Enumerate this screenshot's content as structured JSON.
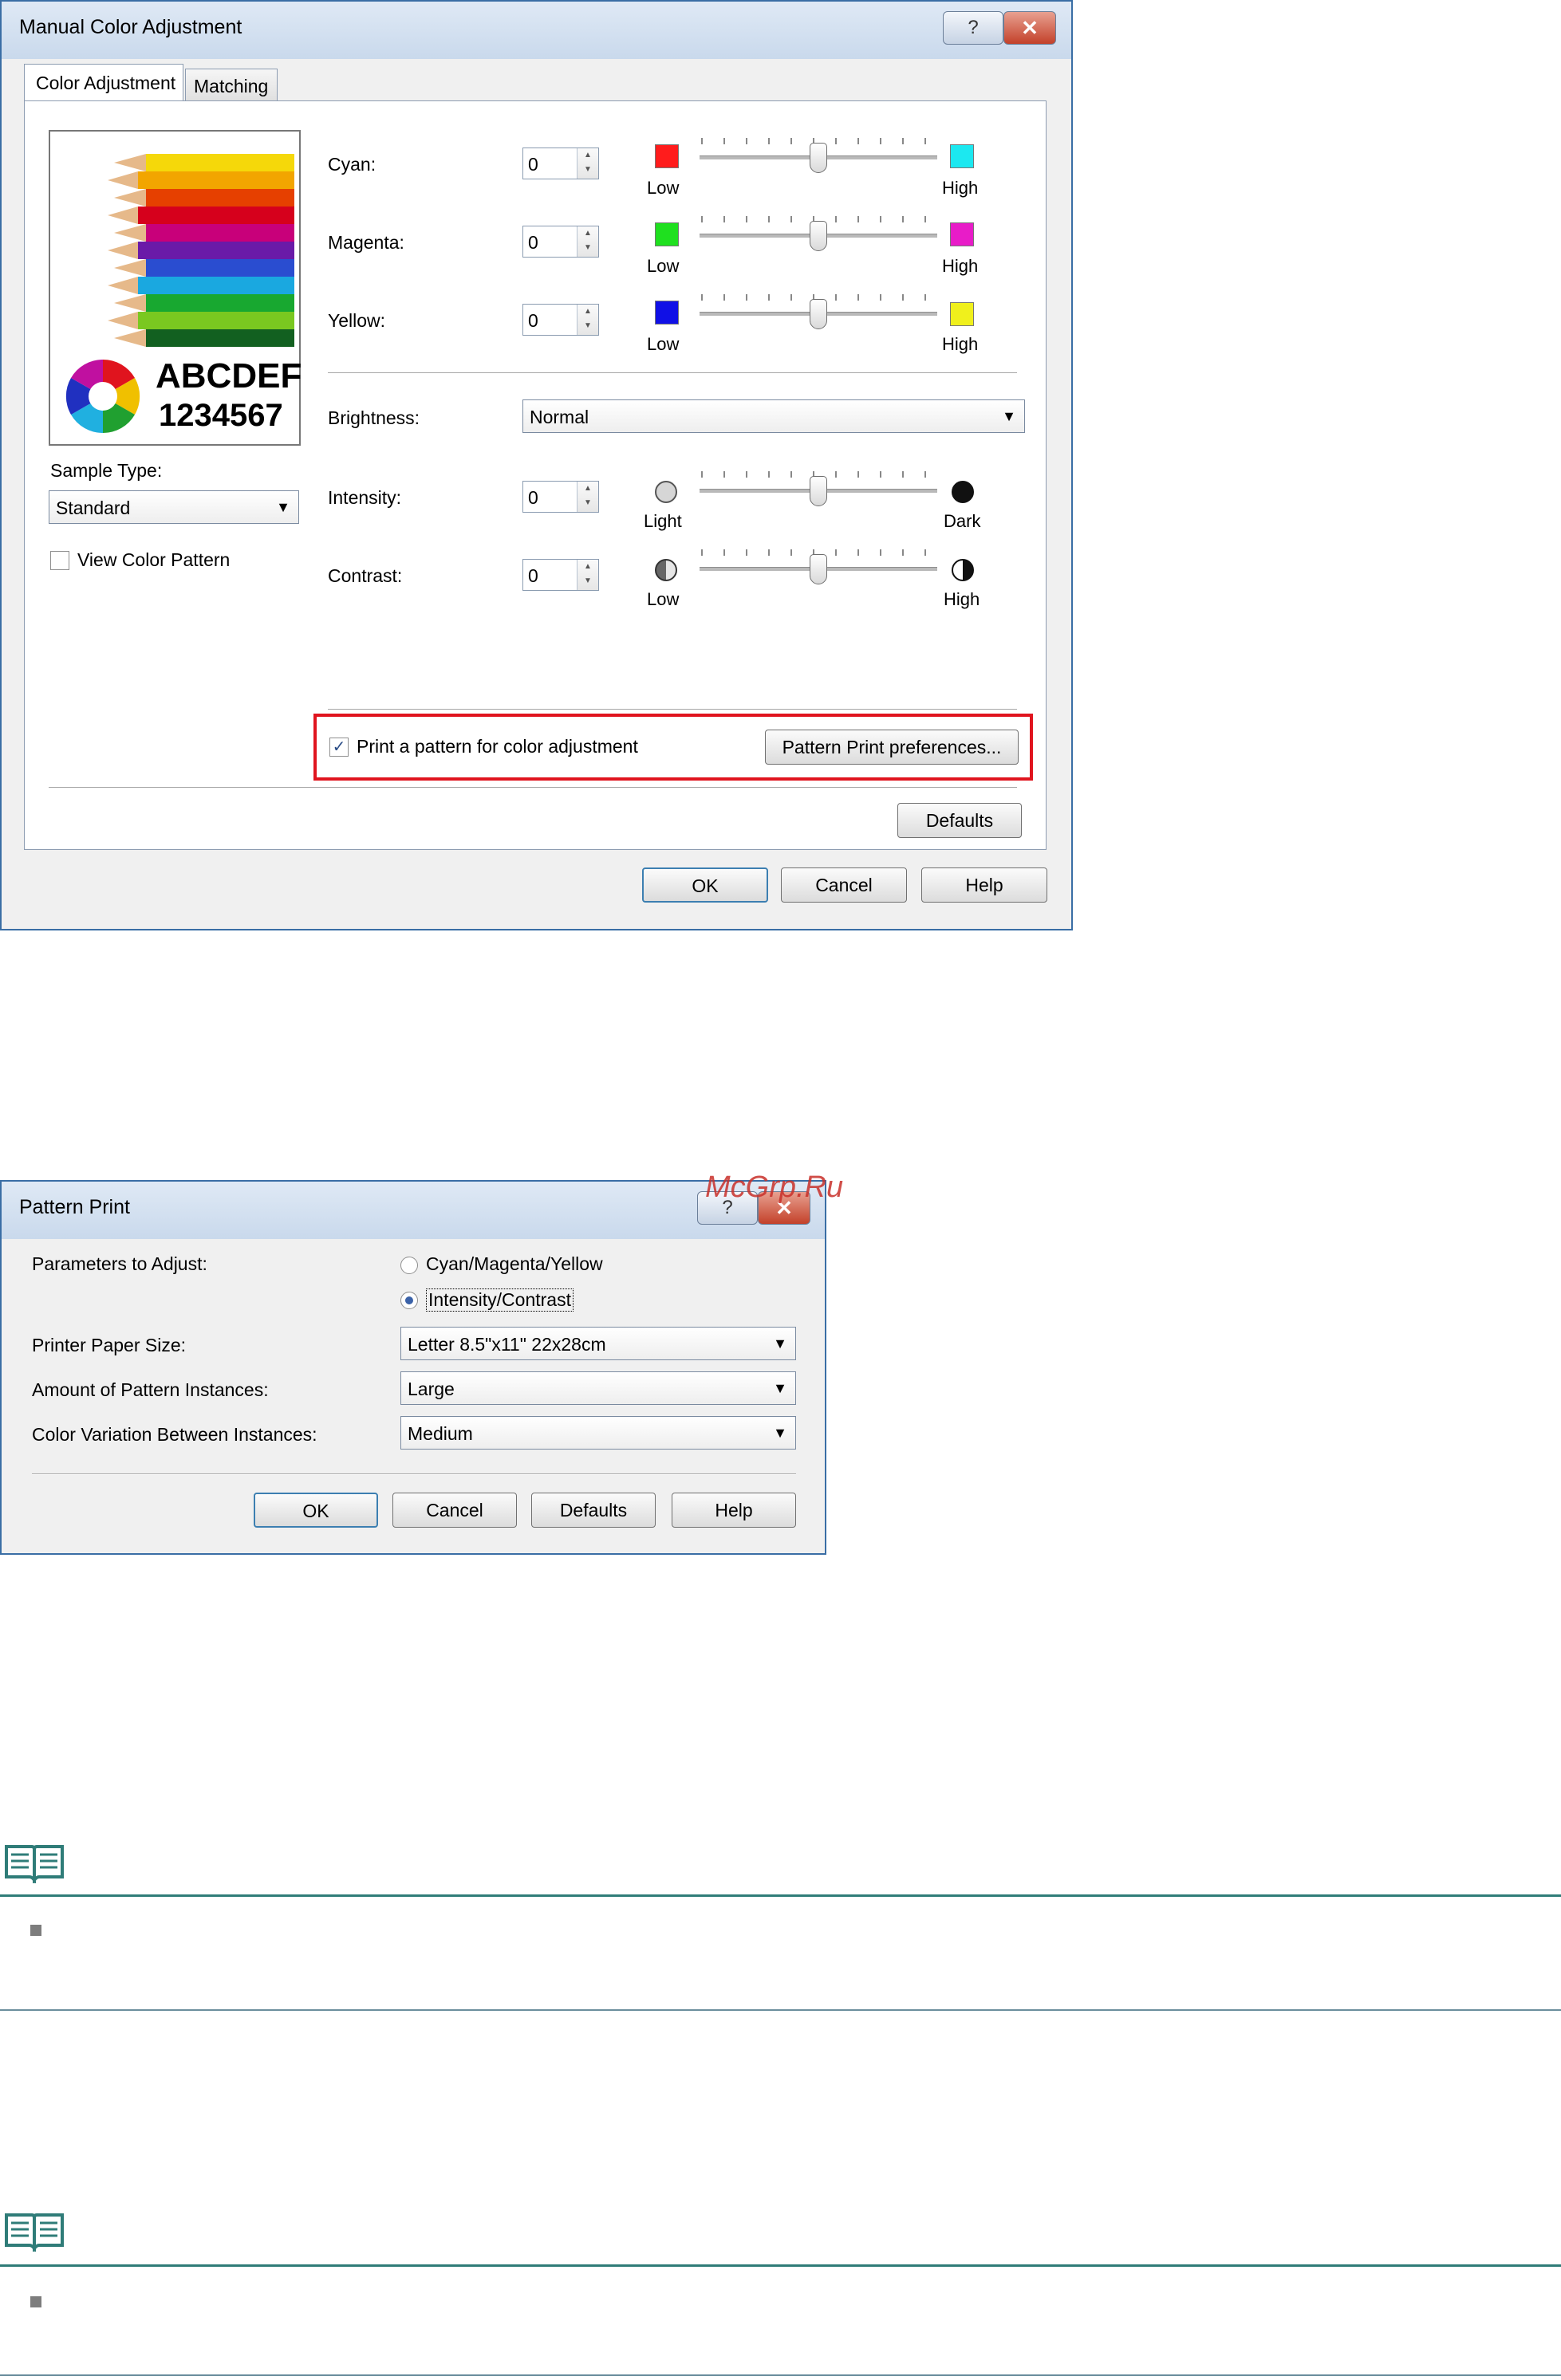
{
  "manual_dialog": {
    "title": "Manual Color Adjustment",
    "help_glyph": "?",
    "close_glyph": "✕",
    "tabs": [
      {
        "label": "Color Adjustment",
        "active": true
      },
      {
        "label": "Matching",
        "active": false
      }
    ],
    "preview": {
      "text_line1": "ABCDEF",
      "text_line2": "1234567"
    },
    "sample_type_label": "Sample Type:",
    "sample_type_value": "Standard",
    "view_color_pattern_label": "View Color Pattern",
    "view_color_pattern_checked": false,
    "sliders": [
      {
        "label": "Cyan:",
        "value": "0",
        "low_label": "Low",
        "high_label": "High",
        "low_color": "#ff1c1c",
        "high_color": "#1ce8f0",
        "position": 0.5
      },
      {
        "label": "Magenta:",
        "value": "0",
        "low_label": "Low",
        "high_label": "High",
        "low_color": "#1fe01f",
        "high_color": "#e81cc8",
        "position": 0.5
      },
      {
        "label": "Yellow:",
        "value": "0",
        "low_label": "Low",
        "high_label": "High",
        "low_color": "#1010e6",
        "high_color": "#f0f01c",
        "position": 0.5
      }
    ],
    "brightness_label": "Brightness:",
    "brightness_value": "Normal",
    "intensity": {
      "label": "Intensity:",
      "value": "0",
      "low_label": "Light",
      "high_label": "Dark",
      "position": 0.5
    },
    "contrast": {
      "label": "Contrast:",
      "value": "0",
      "low_label": "Low",
      "high_label": "High",
      "position": 0.5
    },
    "print_pattern_label": "Print a pattern for color adjustment",
    "print_pattern_checked": true,
    "pattern_prefs_button": "Pattern Print preferences...",
    "highlight_color": "#e0141e",
    "defaults_button": "Defaults",
    "ok_button": "OK",
    "cancel_button": "Cancel",
    "help_button": "Help"
  },
  "watermark": "McGrp.Ru",
  "pattern_dialog": {
    "title": "Pattern Print",
    "help_glyph": "?",
    "close_glyph": "✕",
    "params_label": "Parameters to Adjust:",
    "radio_options": [
      {
        "label": "Cyan/Magenta/Yellow",
        "selected": false
      },
      {
        "label": "Intensity/Contrast",
        "selected": true
      }
    ],
    "paper_size_label": "Printer Paper Size:",
    "paper_size_value": "Letter 8.5\"x11\" 22x28cm",
    "amount_label": "Amount of Pattern Instances:",
    "amount_value": "Large",
    "variation_label": "Color Variation Between Instances:",
    "variation_value": "Medium",
    "ok_button": "OK",
    "cancel_button": "Cancel",
    "defaults_button": "Defaults",
    "help_button": "Help"
  },
  "notes": [
    {
      "icon": "note-book-icon"
    },
    {
      "icon": "note-book-icon"
    }
  ],
  "colors": {
    "accent": "#3a6ea5",
    "note_line": "#2f7c78"
  }
}
